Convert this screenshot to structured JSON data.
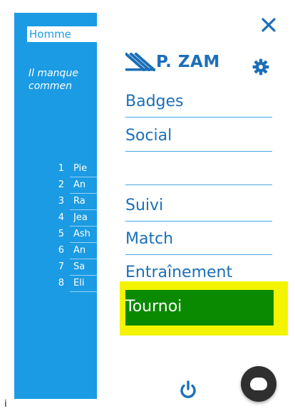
{
  "background_app": {
    "tab_label": "Homme",
    "message": [
      "Il manque",
      "commen"
    ],
    "ranking": [
      {
        "rank": "1",
        "name": "Pie"
      },
      {
        "rank": "2",
        "name": "An"
      },
      {
        "rank": "3",
        "name": "Ra"
      },
      {
        "rank": "4",
        "name": "Jea"
      },
      {
        "rank": "5",
        "name": "Ash"
      },
      {
        "rank": "6",
        "name": "An"
      },
      {
        "rank": "7",
        "name": "Sa"
      },
      {
        "rank": "8",
        "name": "Eli"
      }
    ],
    "accent_color": "#1b9be3"
  },
  "info_glyph": "i",
  "drawer": {
    "close_icon": "close-icon",
    "brand_name": "P. ZAM",
    "settings_icon": "gear-icon",
    "menu": [
      {
        "label": "Badges"
      },
      {
        "label": "Social"
      },
      {
        "label": ""
      },
      {
        "label": "Suivi"
      },
      {
        "label": "Match"
      },
      {
        "label": "Entraînement"
      },
      {
        "label": "Tournoi",
        "highlighted": true
      }
    ],
    "power_icon": "power-icon",
    "fab_icon": "chat-bubble-icon",
    "text_color": "#1b6fb8",
    "highlight_color": "#0a8a00",
    "highlight_band_color": "#f4f400"
  }
}
